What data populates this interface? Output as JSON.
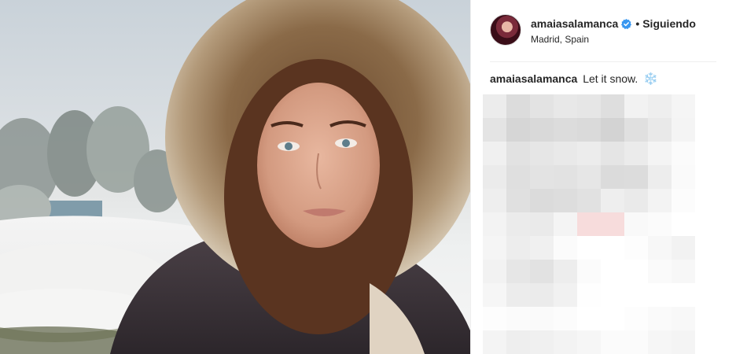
{
  "post": {
    "username": "amaiasalamanca",
    "follow_status": "Siguiendo",
    "separator": "•",
    "location": "Madrid, Spain",
    "caption_user": "amaiasalamanca",
    "caption_text": "Let it snow.",
    "caption_emoji": "❄️"
  },
  "icons": {
    "verified": "verified-badge-icon",
    "emoji": "snowflake-icon"
  },
  "colors": {
    "text": "#262626",
    "verified_blue": "#3897f0",
    "divider": "#efefef"
  }
}
